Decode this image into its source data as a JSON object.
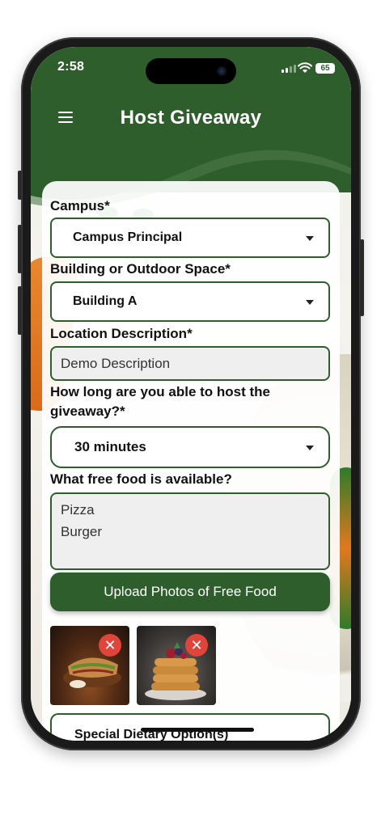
{
  "status_bar": {
    "time": "2:58",
    "battery": "65"
  },
  "header": {
    "title": "Host Giveaway"
  },
  "form": {
    "campus": {
      "label": "Campus*",
      "value": "Campus Principal"
    },
    "building": {
      "label": "Building or Outdoor Space*",
      "value": "Building A"
    },
    "location": {
      "label": "Location Description*",
      "value": "Demo Description"
    },
    "duration": {
      "label_line1": "How long are you able to host the",
      "label_line2": "giveaway?*",
      "value": "30 minutes"
    },
    "food": {
      "label": "What free food is available?",
      "lines": [
        "Pizza",
        "Burger"
      ]
    },
    "upload_button": "Upload Photos of Free Food",
    "photos": [
      {
        "alt": "sandwich photo",
        "remove": "✕"
      },
      {
        "alt": "pancake stack photo",
        "remove": "✕"
      }
    ],
    "special": {
      "label": "Special Dietary Option(s)"
    }
  },
  "colors": {
    "primary": "#2e5e2c",
    "remove": "#e0453b"
  },
  "icons": {
    "menu": "hamburger-icon",
    "dropdown": "caret-down-icon",
    "remove": "close-icon"
  }
}
